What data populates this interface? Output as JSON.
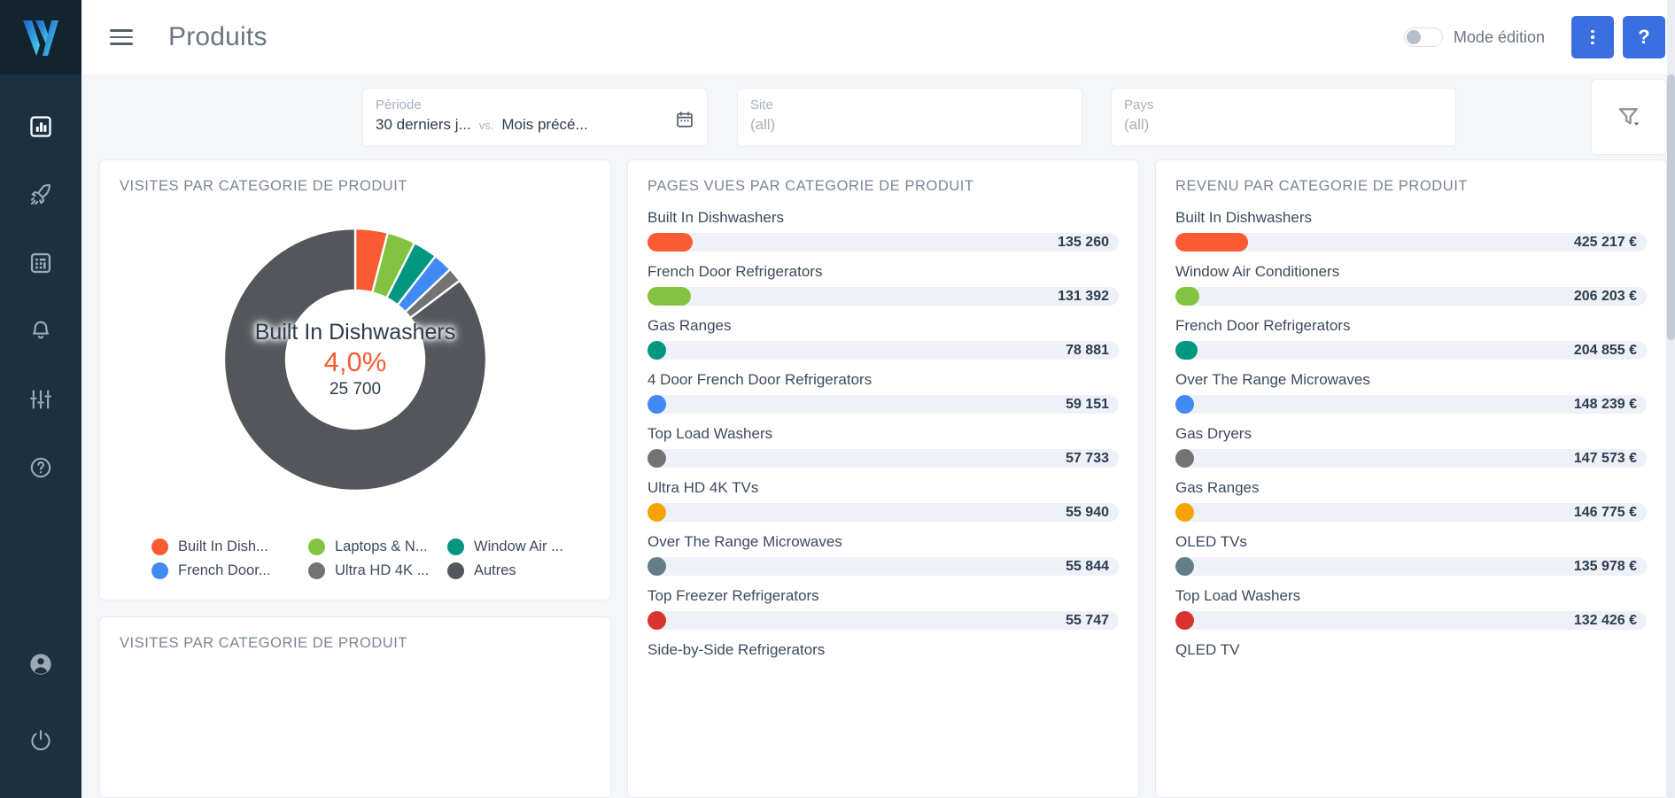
{
  "brand": {
    "logo_icon": "w-logo-icon",
    "accent": "#3b6fe0",
    "sidebar_bg": "#1b3040"
  },
  "header": {
    "title": "Produits",
    "menu_icon": "hamburger-menu-icon",
    "edit_mode_label": "Mode édition",
    "edit_mode_on": false,
    "more_icon": "kebab-menu-icon",
    "help_label": "?"
  },
  "sidebar": {
    "items": [
      {
        "icon": "bar-chart-icon",
        "active": true
      },
      {
        "icon": "rocket-icon",
        "active": false
      },
      {
        "icon": "table-grid-icon",
        "active": false
      },
      {
        "icon": "bell-icon",
        "active": false
      },
      {
        "icon": "sliders-icon",
        "active": false
      },
      {
        "icon": "help-circle-icon",
        "active": false
      }
    ],
    "bottom_items": [
      {
        "icon": "user-account-icon"
      },
      {
        "icon": "power-icon"
      }
    ]
  },
  "filters": {
    "period": {
      "label": "Période",
      "value": "30 derniers j...",
      "compare_word": "vs.",
      "compare_value": "Mois précé...",
      "icon": "calendar-icon"
    },
    "site": {
      "label": "Site",
      "value": "(all)"
    },
    "country": {
      "label": "Pays",
      "value": "(all)"
    },
    "funnel_icon": "filter-funnel-icon"
  },
  "panels": {
    "visits_donut_title": "VISITES PAR CATEGORIE DE PRODUIT",
    "visits_second_title": "VISITES PAR CATEGORIE DE PRODUIT",
    "pageviews_title": "PAGES VUES PAR CATEGORIE DE PRODUIT",
    "revenue_title": "REVENU PAR CATEGORIE DE PRODUIT"
  },
  "donut_center": {
    "name": "Built In Dishwashers",
    "percent": "4,0%",
    "value": "25 700"
  },
  "legend": [
    {
      "label": "Built In Dish...",
      "color": "#fb5b33"
    },
    {
      "label": "Laptops & N...",
      "color": "#82c341"
    },
    {
      "label": "Window Air ...",
      "color": "#009680"
    },
    {
      "label": "French Door...",
      "color": "#4189f4"
    },
    {
      "label": "Ultra HD 4K ...",
      "color": "#737373"
    },
    {
      "label": "Autres",
      "color": "#53565b"
    }
  ],
  "chart_data": [
    {
      "type": "pie",
      "title": "VISITES PAR CATEGORIE DE PRODUIT",
      "donut": true,
      "center_label": "Built In Dishwashers",
      "center_percent": "4,0%",
      "center_value": "25 700",
      "legend_position": "bottom",
      "categories": [
        "Built In Dish...",
        "Laptops & N...",
        "Window Air ...",
        "French Door...",
        "Ultra HD 4K ...",
        "Autres"
      ],
      "values": [
        4.0,
        3.5,
        3.0,
        2.4,
        1.8,
        85.3
      ],
      "colors": [
        "#fb5b33",
        "#82c341",
        "#009680",
        "#4189f4",
        "#737373",
        "#53565b"
      ]
    },
    {
      "type": "bar",
      "title": "PAGES VUES PAR CATEGORIE DE PRODUIT",
      "orientation": "horizontal",
      "xlabel": "",
      "ylabel": "",
      "categories": [
        "Built In Dishwashers",
        "French Door Refrigerators",
        "Gas Ranges",
        "4 Door French Door Refrigerators",
        "Top Load Washers",
        "Ultra HD 4K TVs",
        "Over The Range Microwaves",
        "Top Freezer Refrigerators",
        "Side-by-Side Refrigerators"
      ],
      "values": [
        135260,
        131392,
        78881,
        59151,
        57733,
        55940,
        55844,
        55747,
        null
      ],
      "value_labels": [
        "135 260",
        "131 392",
        "78 881",
        "59 151",
        "57 733",
        "55 940",
        "55 844",
        "55 747",
        ""
      ],
      "colors": [
        "#fb5b33",
        "#82c341",
        "#009680",
        "#4189f4",
        "#737373",
        "#f6a208",
        "#637d8a",
        "#d8332f",
        "#53565b"
      ],
      "bar_pct": [
        9.5,
        9.3,
        4.0,
        2.3,
        2.2,
        2.1,
        2.1,
        2.1,
        0
      ]
    },
    {
      "type": "bar",
      "title": "REVENU PAR CATEGORIE DE PRODUIT",
      "orientation": "horizontal",
      "unit": "€",
      "categories": [
        "Built In Dishwashers",
        "Window Air Conditioners",
        "French Door Refrigerators",
        "Over The Range Microwaves",
        "Gas Dryers",
        "Gas Ranges",
        "OLED TVs",
        "Top Load Washers",
        "QLED TV"
      ],
      "values": [
        425217,
        206203,
        204855,
        148239,
        147573,
        146775,
        135978,
        132426,
        null
      ],
      "value_labels": [
        "425 217 €",
        "206 203 €",
        "204 855 €",
        "148 239 €",
        "147 573 €",
        "146 775 €",
        "135 978 €",
        "132 426 €",
        ""
      ],
      "colors": [
        "#fb5b33",
        "#82c341",
        "#009680",
        "#4189f4",
        "#737373",
        "#f6a208",
        "#637d8a",
        "#d8332f",
        "#53565b"
      ],
      "bar_pct": [
        15.5,
        5.0,
        4.7,
        2.4,
        2.3,
        2.3,
        2.2,
        2.2,
        0
      ]
    }
  ]
}
